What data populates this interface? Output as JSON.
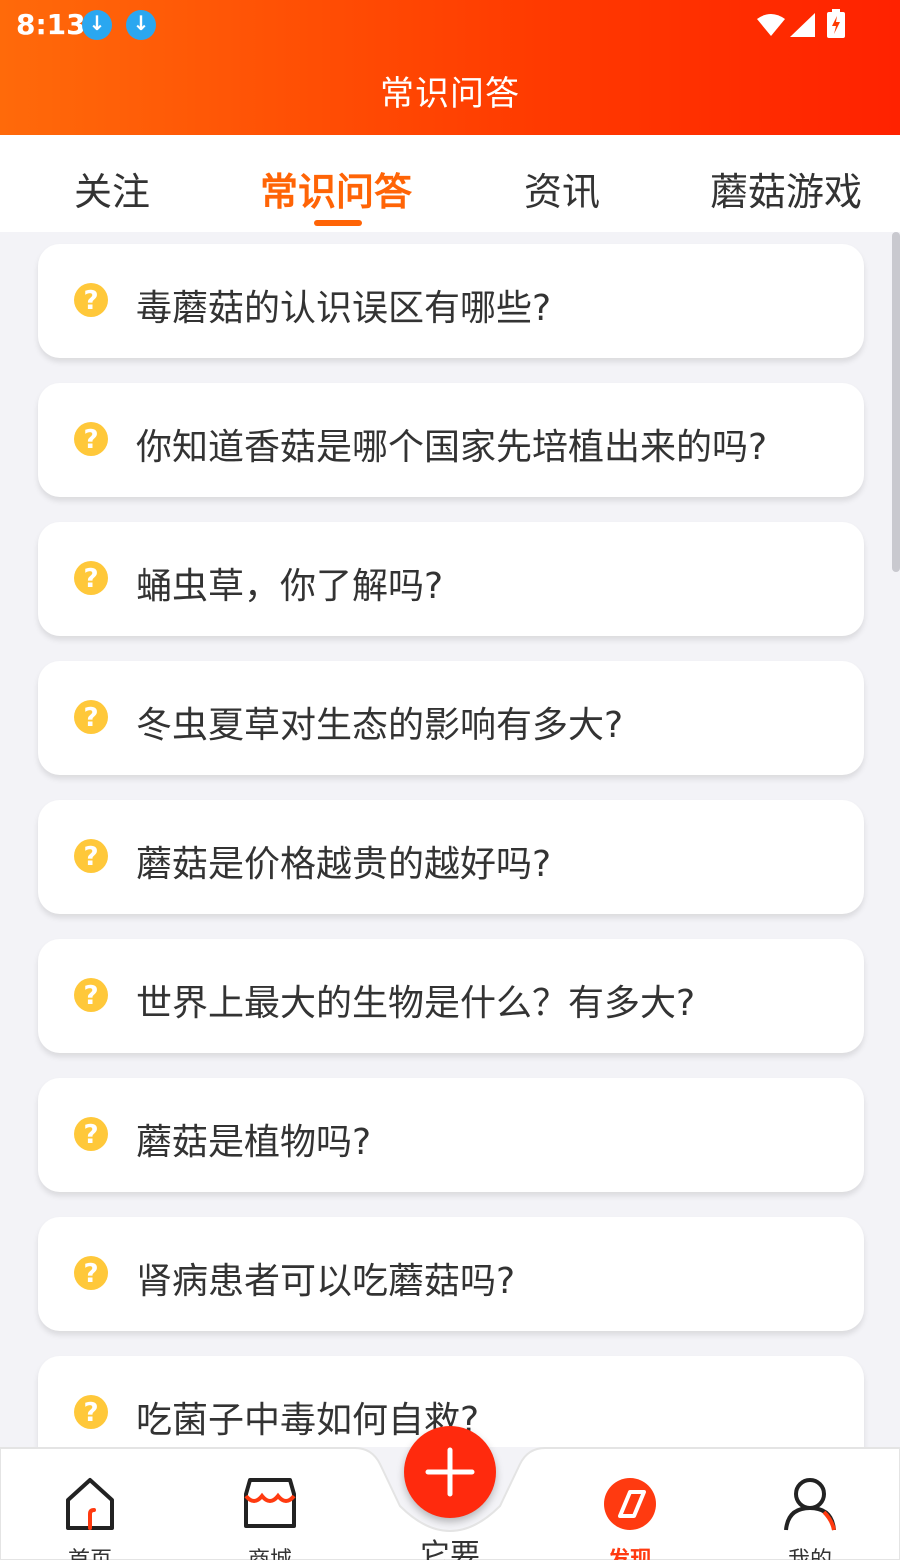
{
  "status_bar": {
    "time": "8:13",
    "icons": [
      "download-icon",
      "download-icon",
      "wifi-icon",
      "signal-icon",
      "battery-charging-icon"
    ]
  },
  "header": {
    "title": "常识问答"
  },
  "tabs": [
    {
      "label": "关注",
      "active": false
    },
    {
      "label": "常识问答",
      "active": true
    },
    {
      "label": "资讯",
      "active": false
    },
    {
      "label": "蘑菇游戏",
      "active": false
    }
  ],
  "questions": [
    "毒蘑菇的认识误区有哪些?",
    "你知道香菇是哪个国家先培植出来的吗?",
    "蛹虫草，你了解吗?",
    "冬虫夏草对生态的影响有多大?",
    "蘑菇是价格越贵的越好吗?",
    "世界上最大的生物是什么？有多大?",
    "蘑菇是植物吗?",
    "肾病患者可以吃蘑菇吗?",
    "吃菌子中毒如何自救?"
  ],
  "bottom_nav": {
    "items": [
      {
        "label": "首页",
        "icon": "home-icon",
        "active": false
      },
      {
        "label": "商城",
        "icon": "shop-icon",
        "active": false
      },
      {
        "label": "发现",
        "icon": "discover-icon",
        "active": true
      },
      {
        "label": "我的",
        "icon": "profile-icon",
        "active": false
      }
    ],
    "fab": {
      "icon": "plus-icon",
      "label": "它要"
    }
  },
  "colors": {
    "header_gradient_start": "#ff6a0a",
    "header_gradient_end": "#ff2200",
    "accent": "#ff6406",
    "question_icon": "#ffc83a"
  }
}
